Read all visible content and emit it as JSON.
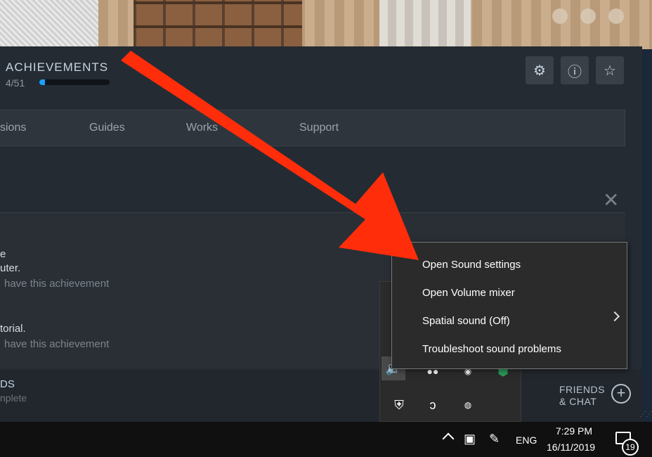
{
  "achievements": {
    "title": "ACHIEVEMENTS",
    "count": "4/51",
    "progress_percent": 8
  },
  "tabs": [
    "ssions",
    "Guides",
    "Works",
    "Support"
  ],
  "achievement_rows": [
    {
      "line1": "e",
      "line2": "uter.",
      "line3": "have this achievement"
    },
    {
      "line1": "torial.",
      "line2": "have this achievement"
    }
  ],
  "downloads": {
    "label": "DS",
    "sub": "nplete"
  },
  "friends": {
    "line1": "FRIENDS",
    "line2": "& CHAT"
  },
  "context_menu": {
    "items": [
      "Open Sound settings",
      "Open Volume mixer",
      "Spatial sound (Off)",
      "Troubleshoot sound problems"
    ]
  },
  "taskbar": {
    "language": "ENG",
    "time": "7:29 PM",
    "date": "16/11/2019",
    "notification_count": "19"
  },
  "colors": {
    "arrow": "#ff2d0a",
    "accent": "#1a9fff"
  }
}
